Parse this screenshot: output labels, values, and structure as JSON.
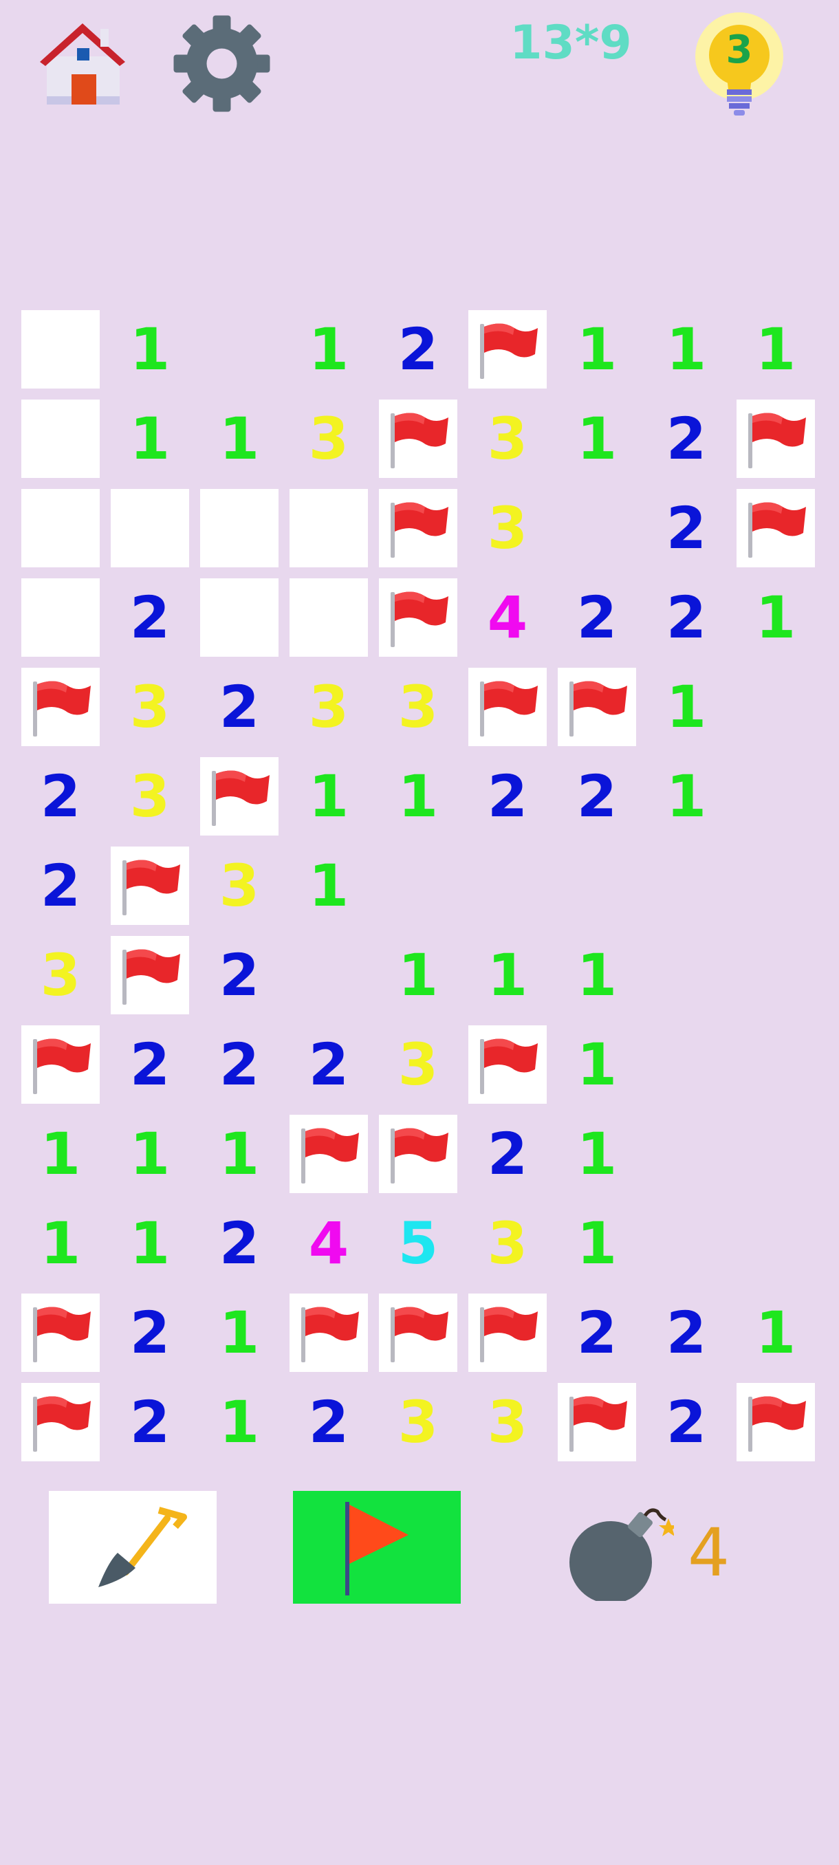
{
  "header": {
    "level_label": "13*9",
    "hints_remaining": "3"
  },
  "board": {
    "rows": 13,
    "cols": 9,
    "cells": [
      [
        "o",
        "1",
        "",
        "1",
        "2",
        "F",
        "1",
        "1",
        "1"
      ],
      [
        "o",
        "1",
        "1",
        "3",
        "F",
        "3",
        "1",
        "2",
        "F"
      ],
      [
        "o",
        "o",
        "o",
        "o",
        "F",
        "3",
        "",
        "2",
        "F"
      ],
      [
        "o",
        "2",
        "o",
        "o",
        "F",
        "4",
        "2",
        "2",
        "1"
      ],
      [
        "F",
        "3",
        "2",
        "3",
        "3",
        "F",
        "F",
        "1",
        ""
      ],
      [
        "2",
        "3",
        "F",
        "1",
        "1",
        "2",
        "2",
        "1",
        ""
      ],
      [
        "2",
        "F",
        "3",
        "1",
        "",
        "",
        "",
        "",
        ""
      ],
      [
        "3",
        "F",
        "2",
        "",
        "1",
        "1",
        "1",
        "",
        ""
      ],
      [
        "F",
        "2",
        "2",
        "2",
        "3",
        "F",
        "1",
        "",
        ""
      ],
      [
        "1",
        "1",
        "1",
        "F",
        "F",
        "2",
        "1",
        "",
        ""
      ],
      [
        "1",
        "1",
        "2",
        "4",
        "5",
        "3",
        "1",
        "",
        ""
      ],
      [
        "F",
        "2",
        "1",
        "F",
        "F",
        "F",
        "2",
        "2",
        "1"
      ],
      [
        "F",
        "2",
        "1",
        "2",
        "3",
        "3",
        "F",
        "2",
        "F"
      ]
    ]
  },
  "toolbar": {
    "mines_remaining": "4"
  },
  "colors": {
    "background": "#e8d8ee",
    "flag_tool_active": "#12e23e",
    "number_1": "#1ee61e",
    "number_2": "#0a14d8",
    "number_3": "#f3f321",
    "number_4": "#f00af0",
    "number_5": "#1ee6f0"
  }
}
